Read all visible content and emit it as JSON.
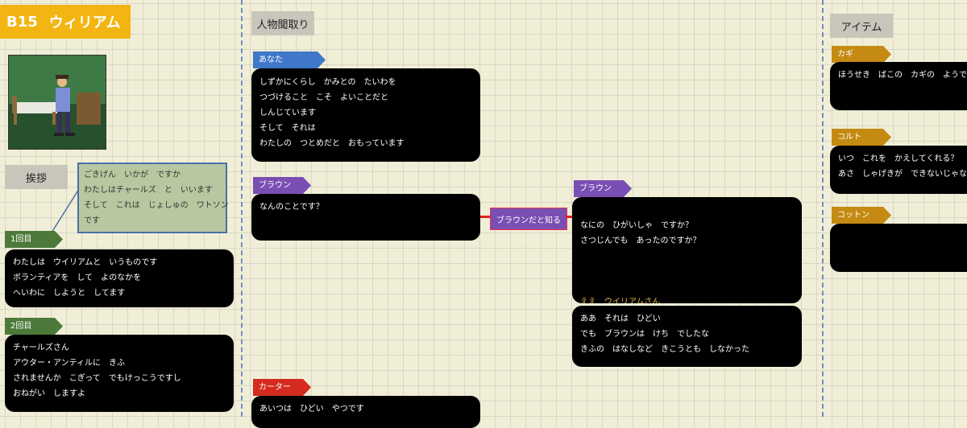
{
  "character": {
    "code": "B15",
    "name": "ウィリアム"
  },
  "sections": {
    "greeting": "挨拶",
    "relations": "人物聞取り",
    "items": "アイテム"
  },
  "note": "ごきげん　いかが　ですか\nわたしはチャールズ　と　いいます\nそして　これは　じょしゅの　ワトソン\nです",
  "visits": [
    {
      "tag": "1回目",
      "text": "わたしは　ウイリアムと　いうものです\nボランティアを　して　よのなかを\nへいわに　しようと　してます"
    },
    {
      "tag": "2回目",
      "text": "チャールズさん\nアウター・アンティルに　きふ\nされませんか　こぎって　でもけっこうですし\nおねがい　しますよ"
    }
  ],
  "people": {
    "you": {
      "tag": "あなた",
      "text": "しずかにくらし　かみとの　たいわを\nつづけること　こそ　よいことだと\nしんじています\nそして　それは\nわたしの　つとめだと　おもっています"
    },
    "brown": {
      "tag": "ブラウン",
      "text": "なんのことです？"
    },
    "carter": {
      "tag": "カーター",
      "text": "あいつは　ひどい　やつです"
    },
    "event_label": "ブラウンだと知る",
    "brown2": {
      "tag": "ブラウン",
      "text1": "なにの　ひがいしゃ　ですか？\nさつじんでも　あったのですか？",
      "text2": "ええ　ウイリアムさん\nおきのどくに　ブラウンさんが\nさつがい　された　のです",
      "text3": "ああ　それは　ひどい\nでも　ブラウンは　けち　でしたな\nきふの　はなしなど　きこうとも　しなかった"
    }
  },
  "items": [
    {
      "tag": "カギ",
      "text": "ほうせき　ばこの　カギの　ようで"
    },
    {
      "tag": "コルト",
      "text": "いつ　これを　かえしてくれる？\nあさ　しゃげきが　できないじゃな"
    },
    {
      "tag": "コットン",
      "text": ""
    }
  ],
  "colors": {
    "you": "#3f78c8",
    "brown": "#7a4fb3",
    "carter": "#d42b1e",
    "visit": "#4d7a3a",
    "item": "#c48a12",
    "title": "#f3b512"
  }
}
